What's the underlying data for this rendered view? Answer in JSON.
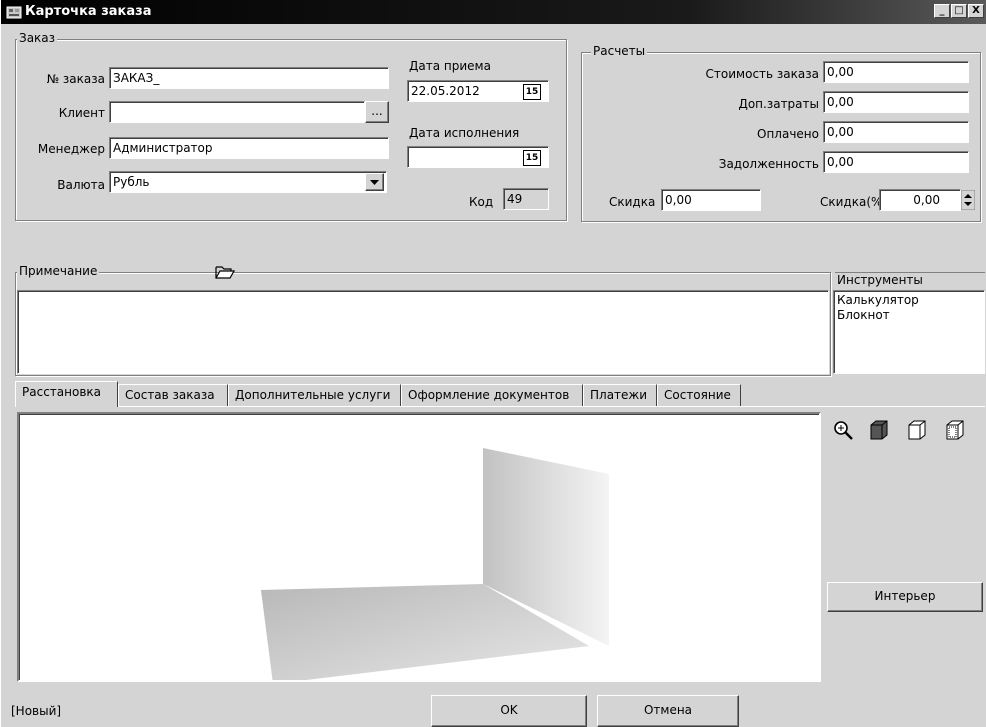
{
  "window": {
    "title": "Карточка заказа",
    "min_label": "_",
    "max_label": "□",
    "close_label": "X"
  },
  "order_group": {
    "caption": "Заказ",
    "order_no_label": "№ заказа",
    "order_no_value": "ЗАКАЗ_",
    "client_label": "Клиент",
    "client_value": "",
    "client_browse": "...",
    "manager_label": "Менеджер",
    "manager_value": "Администратор",
    "currency_label": "Валюта",
    "currency_value": "Рубль",
    "accept_date_label": "Дата приема",
    "accept_date_value": "22.05.2012",
    "done_date_label": "Дата исполнения",
    "done_date_value": "",
    "calendar_glyph": "15",
    "code_label": "Код",
    "code_value": "49"
  },
  "calc_group": {
    "caption": "Расчеты",
    "cost_label": "Стоимость заказа",
    "cost_value": "0,00",
    "extra_label": "Доп.затраты",
    "extra_value": "0,00",
    "paid_label": "Оплачено",
    "paid_value": "0,00",
    "debt_label": "Задолженность",
    "debt_value": "0,00",
    "discount_label": "Скидка",
    "discount_value": "0,00",
    "discount_pct_label": "Скидка(%)",
    "discount_pct_value": "0,00"
  },
  "note": {
    "caption": "Примечание",
    "value": ""
  },
  "tools": {
    "caption": "Инструменты",
    "items": [
      "Калькулятор",
      "Блокнот"
    ]
  },
  "tabs": [
    "Расстановка",
    "Состав заказа",
    "Дополнительные услуги",
    "Оформление документов",
    "Платежи",
    "Состояние"
  ],
  "side_panel": {
    "interior_button": "Интерьер"
  },
  "footer": {
    "status": "[Новый]",
    "ok": "OK",
    "cancel": "Отмена"
  },
  "icons": {
    "zoom": "zoom-icon",
    "cube_solid": "cube-solid-icon",
    "cube_wire": "cube-wireframe-icon",
    "cube_front": "cube-front-icon"
  }
}
